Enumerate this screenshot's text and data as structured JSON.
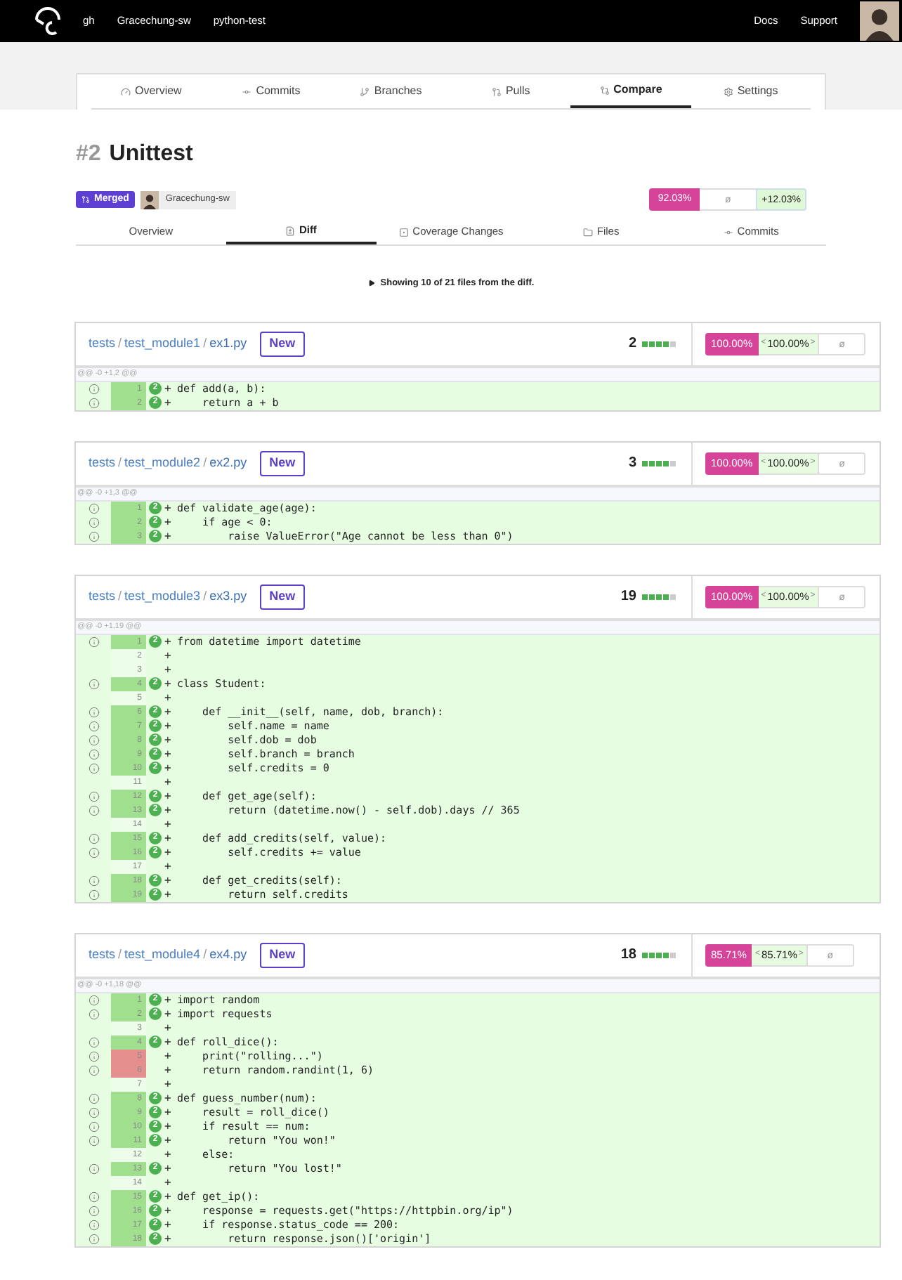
{
  "topbar": {
    "links": [
      "gh",
      "Gracechung-sw",
      "python-test"
    ],
    "right_links": [
      "Docs",
      "Support"
    ]
  },
  "repo_tabs": [
    {
      "label": "Overview",
      "selected": false
    },
    {
      "label": "Commits",
      "selected": false
    },
    {
      "label": "Branches",
      "selected": false
    },
    {
      "label": "Pulls",
      "selected": false
    },
    {
      "label": "Compare",
      "selected": true
    },
    {
      "label": "Settings",
      "selected": false
    }
  ],
  "pull": {
    "number": "#2",
    "title": "Unittest",
    "status": "Merged",
    "author": "Gracechung-sw"
  },
  "summary": {
    "head": "92.03%",
    "base": "ø",
    "change": "+12.03%"
  },
  "pull_tabs": [
    {
      "label": "Overview",
      "selected": false
    },
    {
      "label": "Diff",
      "selected": true
    },
    {
      "label": "Coverage Changes",
      "selected": false
    },
    {
      "label": "Files",
      "selected": false
    },
    {
      "label": "Commits",
      "selected": false
    }
  ],
  "showing": "Showing 10 of 21 files from the diff.",
  "files": [
    {
      "separator": "/",
      "path": [
        "tests",
        "test_module1"
      ],
      "name": "ex1.py",
      "tag": "New",
      "lines_count": "2",
      "level": 0.8,
      "head": "100.00%",
      "change_open": "<",
      "change": "100.00%",
      "change_close": ">",
      "base": "ø",
      "hunk": "@@ -0 +1,2 @@",
      "lines": [
        {
          "n": "1",
          "kind": "hit",
          "hits": "2",
          "sign": "+",
          "code": "def add(a, b):"
        },
        {
          "n": "2",
          "kind": "hit",
          "hits": "2",
          "sign": "+",
          "code": "    return a + b"
        }
      ]
    },
    {
      "separator": "/",
      "path": [
        "tests",
        "test_module2"
      ],
      "name": "ex2.py",
      "tag": "New",
      "lines_count": "3",
      "level": 0.8,
      "head": "100.00%",
      "change_open": "<",
      "change": "100.00%",
      "change_close": ">",
      "base": "ø",
      "hunk": "@@ -0 +1,3 @@",
      "lines": [
        {
          "n": "1",
          "kind": "hit",
          "hits": "2",
          "sign": "+",
          "code": "def validate_age(age):"
        },
        {
          "n": "2",
          "kind": "hit",
          "hits": "2",
          "sign": "+",
          "code": "    if age < 0:"
        },
        {
          "n": "3",
          "kind": "hit",
          "hits": "2",
          "sign": "+",
          "code": "        raise ValueError(\"Age cannot be less than 0\")"
        }
      ]
    },
    {
      "separator": "/",
      "path": [
        "tests",
        "test_module3"
      ],
      "name": "ex3.py",
      "tag": "New",
      "lines_count": "19",
      "level": 0.8,
      "head": "100.00%",
      "change_open": "<",
      "change": "100.00%",
      "change_close": ">",
      "base": "ø",
      "hunk": "@@ -0 +1,19 @@",
      "lines": [
        {
          "n": "1",
          "kind": "hit",
          "hits": "2",
          "sign": "+",
          "code": "from datetime import datetime"
        },
        {
          "n": "2",
          "kind": "none",
          "sign": "+"
        },
        {
          "n": "3",
          "kind": "none",
          "sign": "+"
        },
        {
          "n": "4",
          "kind": "hit",
          "hits": "2",
          "sign": "+",
          "code": "class Student:"
        },
        {
          "n": "5",
          "kind": "none",
          "sign": "+"
        },
        {
          "n": "6",
          "kind": "hit",
          "hits": "2",
          "sign": "+",
          "code": "    def __init__(self, name, dob, branch):"
        },
        {
          "n": "7",
          "kind": "hit",
          "hits": "2",
          "sign": "+",
          "code": "        self.name = name"
        },
        {
          "n": "8",
          "kind": "hit",
          "hits": "2",
          "sign": "+",
          "code": "        self.dob = dob"
        },
        {
          "n": "9",
          "kind": "hit",
          "hits": "2",
          "sign": "+",
          "code": "        self.branch = branch"
        },
        {
          "n": "10",
          "kind": "hit",
          "hits": "2",
          "sign": "+",
          "code": "        self.credits = 0"
        },
        {
          "n": "11",
          "kind": "none",
          "sign": "+"
        },
        {
          "n": "12",
          "kind": "hit",
          "hits": "2",
          "sign": "+",
          "code": "    def get_age(self):"
        },
        {
          "n": "13",
          "kind": "hit",
          "hits": "2",
          "sign": "+",
          "code": "        return (datetime.now() - self.dob).days // 365"
        },
        {
          "n": "14",
          "kind": "none",
          "sign": "+"
        },
        {
          "n": "15",
          "kind": "hit",
          "hits": "2",
          "sign": "+",
          "code": "    def add_credits(self, value):"
        },
        {
          "n": "16",
          "kind": "hit",
          "hits": "2",
          "sign": "+",
          "code": "        self.credits += value"
        },
        {
          "n": "17",
          "kind": "none",
          "sign": "+"
        },
        {
          "n": "18",
          "kind": "hit",
          "hits": "2",
          "sign": "+",
          "code": "    def get_credits(self):"
        },
        {
          "n": "19",
          "kind": "hit",
          "hits": "2",
          "sign": "+",
          "code": "        return self.credits"
        }
      ]
    },
    {
      "separator": "/",
      "path": [
        "tests",
        "test_module4"
      ],
      "name": "ex4.py",
      "tag": "New",
      "lines_count": "18",
      "level": 0.8,
      "head": "85.71%",
      "change_open": "<",
      "change": "85.71%",
      "change_close": ">",
      "base": "ø",
      "hunk": "@@ -0 +1,18 @@",
      "lines": [
        {
          "n": "1",
          "kind": "hit",
          "hits": "2",
          "sign": "+",
          "code": "import random"
        },
        {
          "n": "2",
          "kind": "hit",
          "hits": "2",
          "sign": "+",
          "code": "import requests"
        },
        {
          "n": "3",
          "kind": "none",
          "sign": "+"
        },
        {
          "n": "4",
          "kind": "hit",
          "hits": "2",
          "sign": "+",
          "code": "def roll_dice():"
        },
        {
          "n": "5",
          "kind": "miss",
          "sign": "+",
          "code": "    print(\"rolling...\")"
        },
        {
          "n": "6",
          "kind": "miss",
          "sign": "+",
          "code": "    return random.randint(1, 6)"
        },
        {
          "n": "7",
          "kind": "none",
          "sign": "+"
        },
        {
          "n": "8",
          "kind": "hit",
          "hits": "2",
          "sign": "+",
          "code": "def guess_number(num):"
        },
        {
          "n": "9",
          "kind": "hit",
          "hits": "2",
          "sign": "+",
          "code": "    result = roll_dice()"
        },
        {
          "n": "10",
          "kind": "hit",
          "hits": "2",
          "sign": "+",
          "code": "    if result == num:"
        },
        {
          "n": "11",
          "kind": "hit",
          "hits": "2",
          "sign": "+",
          "code": "        return \"You won!\""
        },
        {
          "n": "12",
          "kind": "none",
          "sign": "+",
          "code": "    else:"
        },
        {
          "n": "13",
          "kind": "hit",
          "hits": "2",
          "sign": "+",
          "code": "        return \"You lost!\""
        },
        {
          "n": "14",
          "kind": "none",
          "sign": "+"
        },
        {
          "n": "15",
          "kind": "hit",
          "hits": "2",
          "sign": "+",
          "code": "def get_ip():"
        },
        {
          "n": "16",
          "kind": "hit",
          "hits": "2",
          "sign": "+",
          "code": "    response = requests.get(\"https://httpbin.org/ip\")"
        },
        {
          "n": "17",
          "kind": "hit",
          "hits": "2",
          "sign": "+",
          "code": "    if response.status_code == 200:"
        },
        {
          "n": "18",
          "kind": "hit",
          "hits": "2",
          "sign": "+",
          "code": "        return response.json()['origin']"
        }
      ]
    }
  ]
}
